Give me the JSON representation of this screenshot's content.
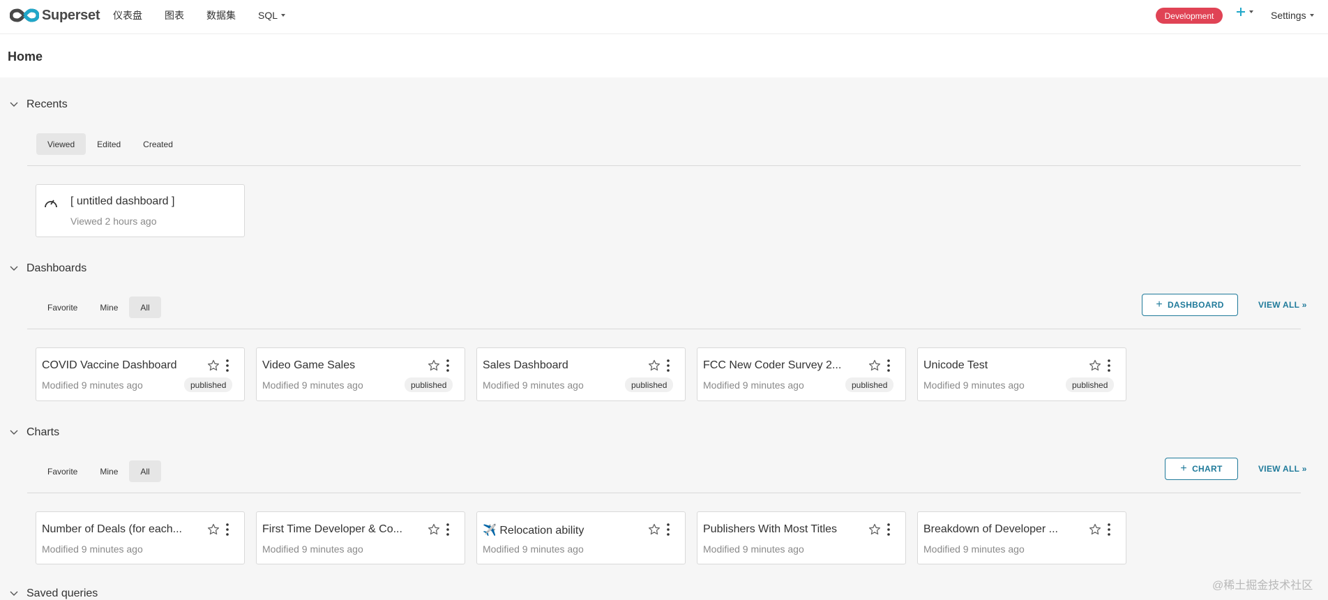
{
  "navbar": {
    "brand": "Superset",
    "menu": [
      {
        "label": "仪表盘",
        "dropdown": false
      },
      {
        "label": "图表",
        "dropdown": false
      },
      {
        "label": "数据集",
        "dropdown": false
      },
      {
        "label": "SQL",
        "dropdown": true
      }
    ],
    "environment": "Development",
    "settings": "Settings",
    "colors": {
      "brand_left": "#484848",
      "brand_right": "#20a7c9",
      "env": "#e04355",
      "accent": "#1f7a9a"
    }
  },
  "page": {
    "title": "Home"
  },
  "recents": {
    "title": "Recents",
    "tabs": [
      "Viewed",
      "Edited",
      "Created"
    ],
    "active_tab": "Viewed",
    "items": [
      {
        "title": "[ untitled dashboard ]",
        "subtitle": "Viewed 2 hours ago",
        "icon": "dashboard-gauge-icon"
      }
    ]
  },
  "dashboards": {
    "title": "Dashboards",
    "tabs": [
      "Favorite",
      "Mine",
      "All"
    ],
    "active_tab": "All",
    "add_label": "DASHBOARD",
    "view_all": "VIEW ALL »",
    "items": [
      {
        "title": "COVID Vaccine Dashboard",
        "modified": "Modified 9 minutes ago",
        "status": "published"
      },
      {
        "title": "Video Game Sales",
        "modified": "Modified 9 minutes ago",
        "status": "published"
      },
      {
        "title": "Sales Dashboard",
        "modified": "Modified 9 minutes ago",
        "status": "published"
      },
      {
        "title": "FCC New Coder Survey 2...",
        "modified": "Modified 9 minutes ago",
        "status": "published"
      },
      {
        "title": "Unicode Test",
        "modified": "Modified 9 minutes ago",
        "status": "published"
      }
    ]
  },
  "charts": {
    "title": "Charts",
    "tabs": [
      "Favorite",
      "Mine",
      "All"
    ],
    "active_tab": "All",
    "add_label": "CHART",
    "view_all": "VIEW ALL »",
    "items": [
      {
        "title": "Number of Deals (for each...",
        "modified": "Modified 9 minutes ago"
      },
      {
        "title": "First Time Developer & Co...",
        "modified": "Modified 9 minutes ago"
      },
      {
        "title": "✈️ Relocation ability",
        "modified": "Modified 9 minutes ago"
      },
      {
        "title": "Publishers With Most Titles",
        "modified": "Modified 9 minutes ago"
      },
      {
        "title": "Breakdown of Developer ...",
        "modified": "Modified 9 minutes ago"
      }
    ]
  },
  "saved_queries": {
    "title": "Saved queries"
  },
  "watermark": "@稀土掘金技术社区"
}
